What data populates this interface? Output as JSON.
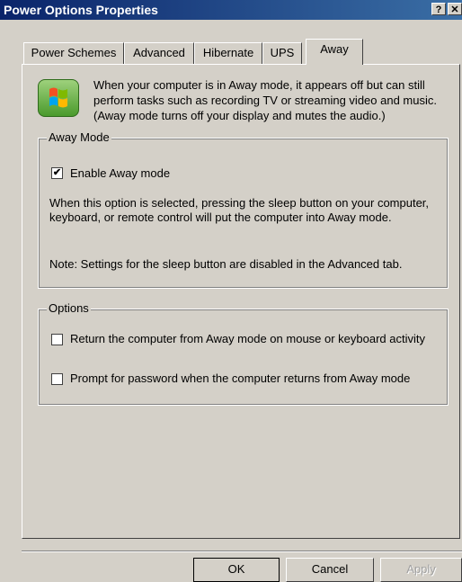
{
  "window": {
    "title": "Power Options Properties",
    "help_glyph": "?",
    "close_glyph": "✕"
  },
  "tabs": [
    {
      "label": "Power Schemes"
    },
    {
      "label": "Advanced"
    },
    {
      "label": "Hibernate"
    },
    {
      "label": "UPS"
    },
    {
      "label": "Away"
    }
  ],
  "active_tab": "Away",
  "intro": {
    "icon": "windows-logo-icon",
    "text": "When your computer is in Away mode, it appears off but can still perform tasks such as recording TV or streaming video and music. (Away mode turns off your display and mutes the audio.)"
  },
  "away_mode": {
    "group_label": "Away Mode",
    "enable": {
      "label": "Enable Away mode",
      "checked": true
    },
    "description": "When this option is selected, pressing the sleep button on your computer, keyboard, or remote control will put the computer into Away mode.",
    "note": "Note: Settings for the sleep button are disabled in the Advanced tab."
  },
  "options": {
    "group_label": "Options",
    "return_on_mouse": {
      "label": "Return the computer from Away mode on mouse or keyboard activity",
      "checked": false
    },
    "prompt_password": {
      "label": "Prompt for password when the computer returns from Away mode",
      "checked": false
    }
  },
  "buttons": {
    "ok": "OK",
    "cancel": "Cancel",
    "apply": "Apply"
  }
}
